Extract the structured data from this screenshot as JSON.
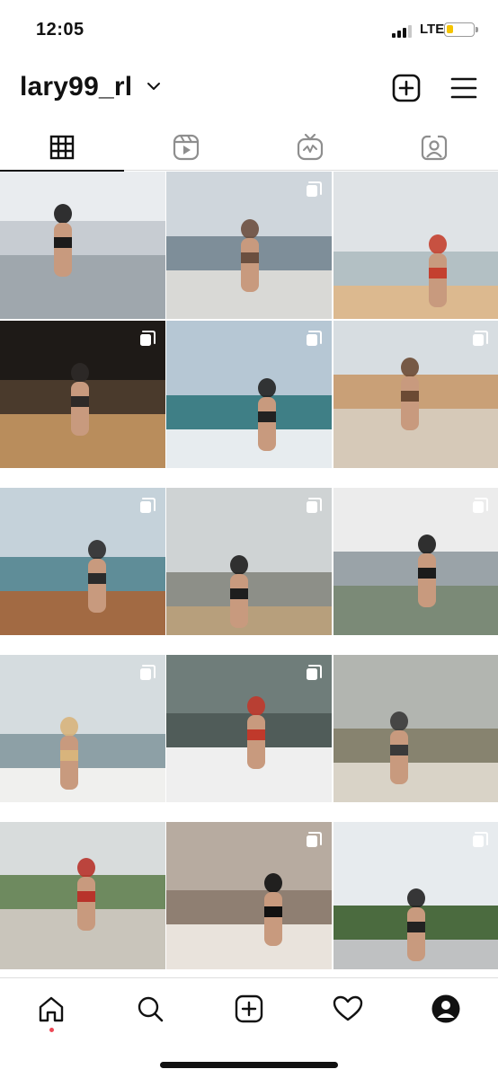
{
  "status_bar": {
    "time": "12:05",
    "network": "LTE",
    "signal_bars": 3,
    "battery_level": 0.25,
    "battery_color": "#f5c400"
  },
  "header": {
    "username": "lary99_rl",
    "chevron_icon": "chevron-down-icon",
    "new_post_icon": "plus-square-icon",
    "menu_icon": "hamburger-menu-icon"
  },
  "tabs": [
    {
      "name": "grid",
      "icon": "grid-icon",
      "active": true
    },
    {
      "name": "reels",
      "icon": "reels-icon",
      "active": false
    },
    {
      "name": "igtv",
      "icon": "igtv-icon",
      "active": false
    },
    {
      "name": "tagged",
      "icon": "tagged-person-icon",
      "active": false
    }
  ],
  "posts": [
    {
      "multi": false,
      "palette": [
        "#e9ecef",
        "#c7ccd2",
        "#9fa7ad",
        "#1b1b1b"
      ]
    },
    {
      "multi": true,
      "palette": [
        "#cfd6dc",
        "#7e8e99",
        "#d9d9d6",
        "#6b4f3f"
      ]
    },
    {
      "multi": false,
      "palette": [
        "#dfe3e6",
        "#b3c0c4",
        "#dcb98f",
        "#c4402f"
      ]
    },
    {
      "multi": true,
      "palette": [
        "#1e1a17",
        "#4a3a2c",
        "#b98d5c",
        "#2d2a28"
      ]
    },
    {
      "multi": true,
      "palette": [
        "#b6c7d4",
        "#3f7f86",
        "#e7ecef",
        "#222222"
      ]
    },
    {
      "multi": true,
      "palette": [
        "#d7dde1",
        "#c9a077",
        "#d6c9b8",
        "#6b4a34"
      ]
    },
    {
      "multi": true,
      "palette": [
        "#c5d2da",
        "#5f8d98",
        "#a26a43",
        "#2b2b2b"
      ]
    },
    {
      "multi": true,
      "palette": [
        "#cfd3d4",
        "#8d8f88",
        "#b79f7c",
        "#1e1e1e"
      ]
    },
    {
      "multi": true,
      "palette": [
        "#ececec",
        "#9aa3a8",
        "#7b8a77",
        "#1b1b1b"
      ]
    },
    {
      "multi": true,
      "palette": [
        "#d5dcdf",
        "#8da0a6",
        "#f0f0ee",
        "#d8b47c"
      ]
    },
    {
      "multi": true,
      "palette": [
        "#6f7d7a",
        "#505c59",
        "#efefef",
        "#c0392b"
      ]
    },
    {
      "multi": false,
      "palette": [
        "#b2b5b0",
        "#87836f",
        "#d9d3c7",
        "#3a3a3a"
      ]
    },
    {
      "multi": false,
      "palette": [
        "#d8dcdc",
        "#6e8a5f",
        "#c9c5bb",
        "#b8332b"
      ]
    },
    {
      "multi": true,
      "palette": [
        "#b7aba0",
        "#8f7f72",
        "#e9e3dc",
        "#111111"
      ]
    },
    {
      "multi": true,
      "palette": [
        "#e7ebee",
        "#4b6b3f",
        "#bfc1c2",
        "#222222"
      ]
    }
  ],
  "bottom_nav": [
    {
      "name": "home",
      "icon": "home-icon",
      "active": true
    },
    {
      "name": "search",
      "icon": "search-icon",
      "active": false
    },
    {
      "name": "create",
      "icon": "plus-square-icon",
      "active": false
    },
    {
      "name": "activity",
      "icon": "heart-icon",
      "active": false
    },
    {
      "name": "profile",
      "icon": "profile-avatar-icon",
      "active": false
    }
  ],
  "colors": {
    "text": "#111111",
    "divider": "#dcdcdc",
    "notification_dot": "#ed4956",
    "background": "#ffffff"
  }
}
